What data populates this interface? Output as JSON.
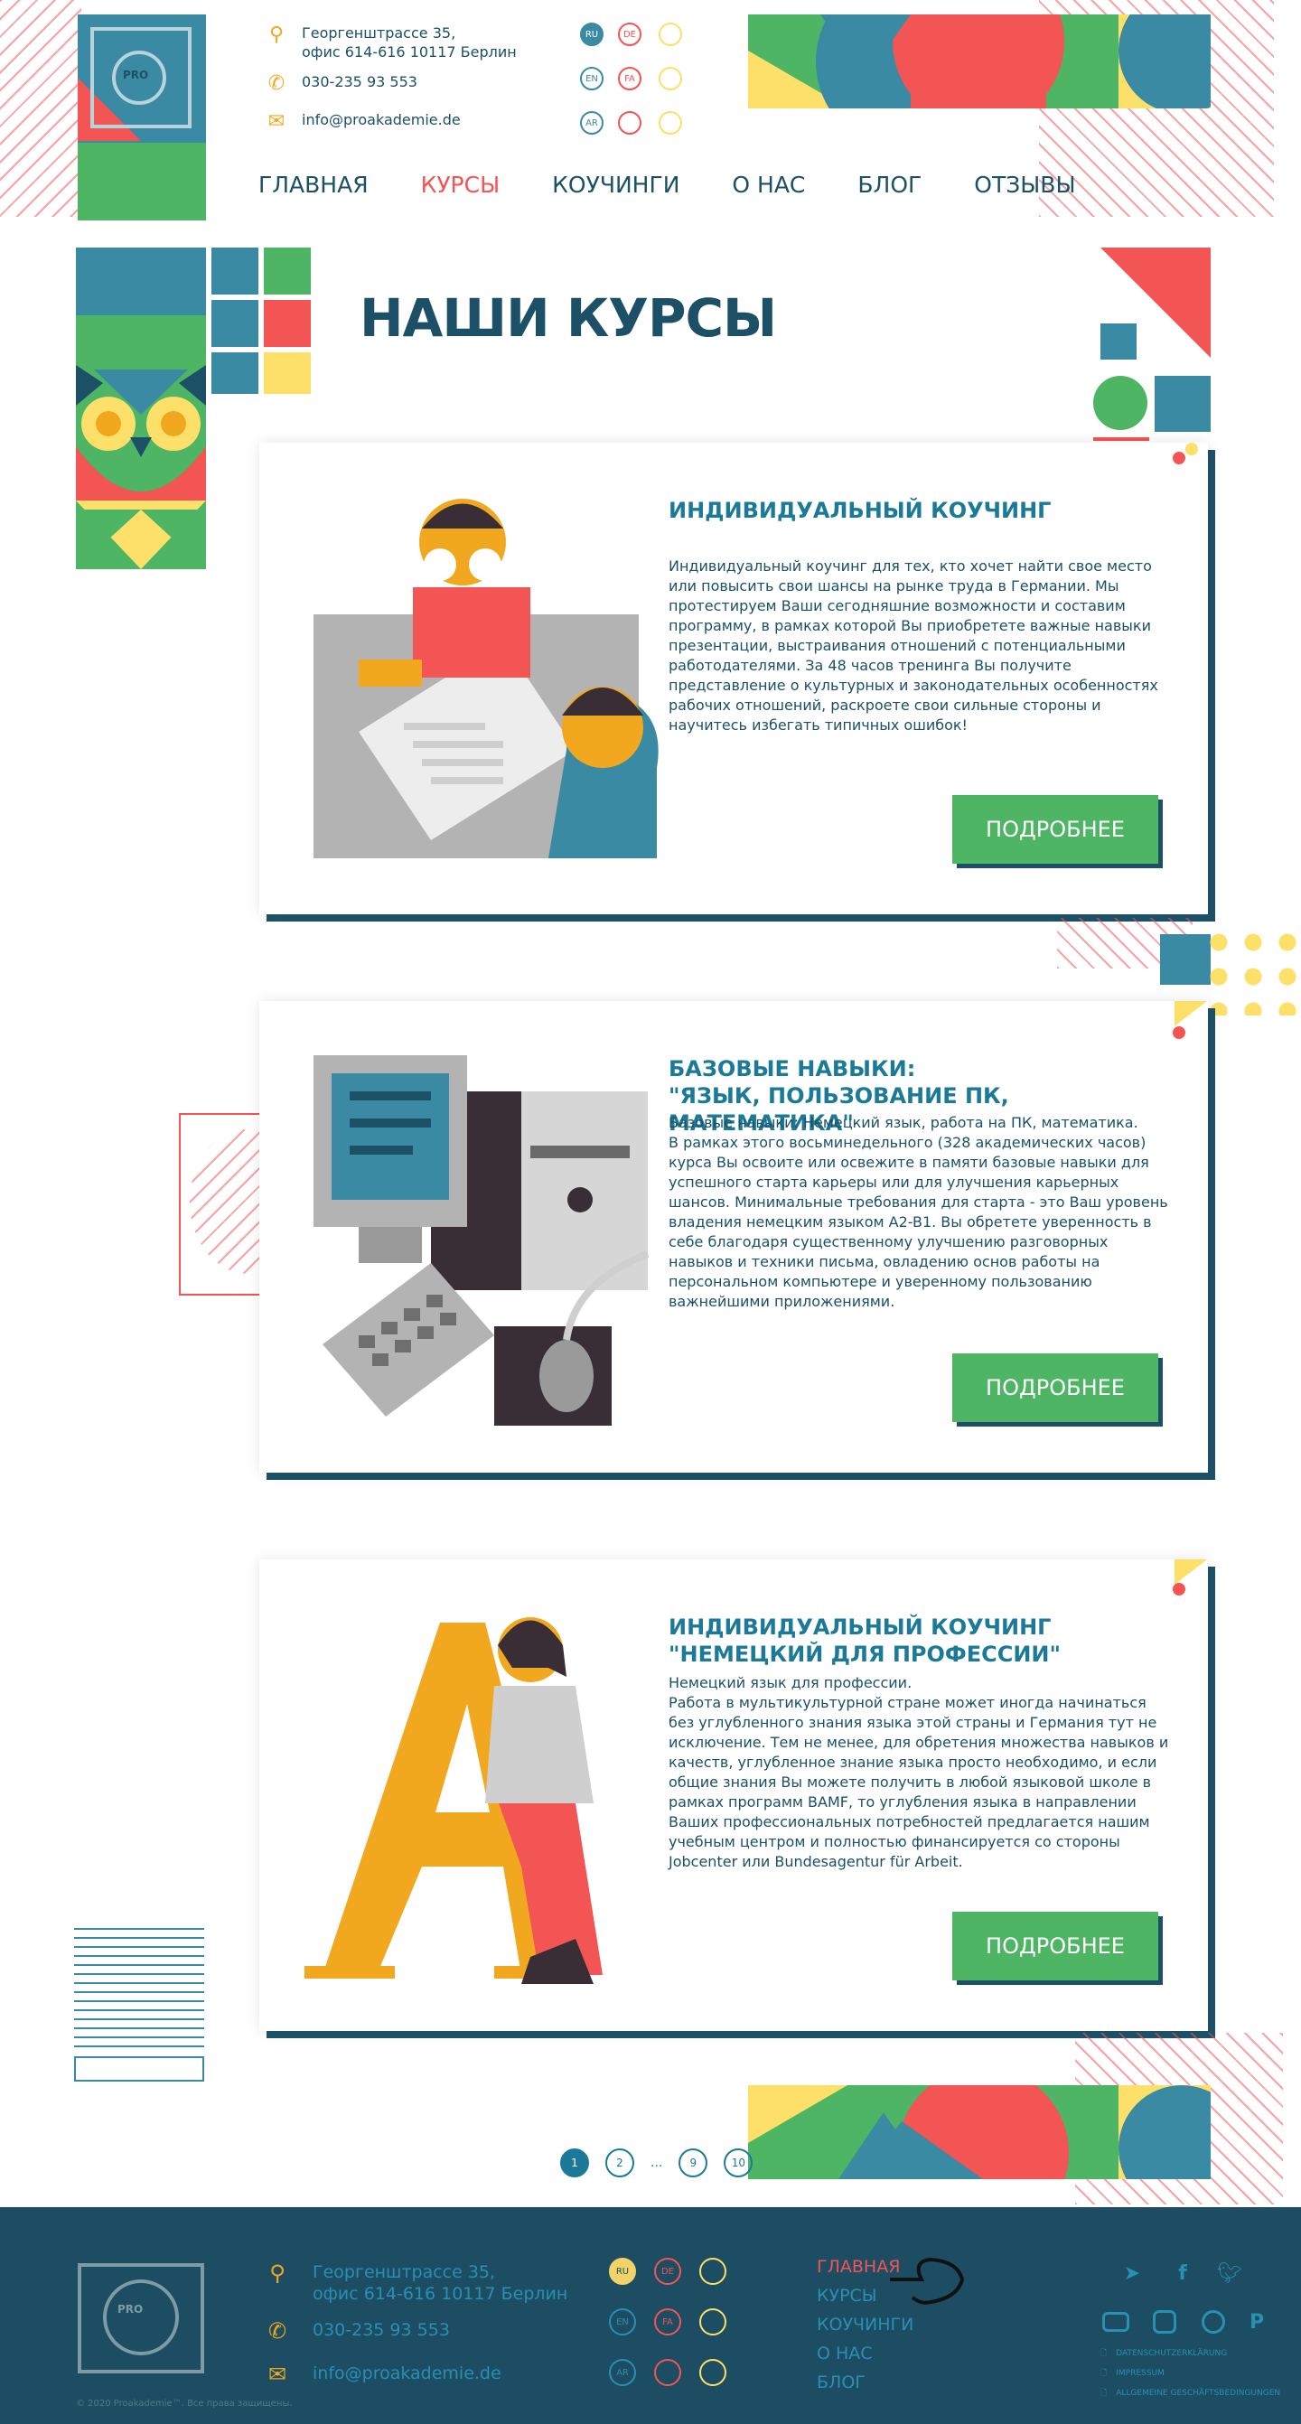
{
  "header": {
    "address_line1": "Георгенштрассе 35,",
    "address_line2": "офис 614-616 10117 Берлин",
    "phone": "030-235 93 553",
    "email": "info@proakademie.de",
    "langs": [
      "RU",
      "DE",
      "",
      "EN",
      "FA",
      "",
      "AR",
      "",
      ""
    ],
    "logo_text": "PRO"
  },
  "nav": {
    "items": [
      "ГЛАВНАЯ",
      "КУРСЫ",
      "КОУЧИНГИ",
      "О НАС",
      "БЛОГ",
      "ОТЗЫВЫ"
    ]
  },
  "page": {
    "title": "НАШИ КУРСЫ"
  },
  "courses": [
    {
      "title": "ИНДИВИДУАЛЬНЫЙ КОУЧИНГ",
      "text": "Индивидуальный коучинг для тех, кто хочет найти свое место или повысить свои шансы на рынке труда в Германии. Мы протестируем Ваши сегодняшние возможности и составим программу, в рамках которой Вы приобретете важные навыки презентации, выстраивания отношений с потенциальными работодателями. За 48 часов тренинга Вы получите представление о культурных и законодательных особенностях рабочих отношений, раскроете свои сильные стороны и научитесь избегать типичных ошибок!",
      "button": "ПОДРОБНЕЕ"
    },
    {
      "title": "БАЗОВЫЕ НАВЫКИ:\n\"ЯЗЫК, ПОЛЬЗОВАНИЕ ПК, МАТЕМАТИКА\"",
      "text": "Базовые навыки: Немецкий язык, работа на ПК, математика.\nВ рамках этого восьминедельного (328 академических часов) курса Вы освоите или освежите в памяти базовые навыки для успешного старта карьеры или для улучшения карьерных шансов. Минимальные требования для старта - это Ваш уровень владения немецким языком A2-B1. Вы обретете уверенность в себе благодаря существенному улучшению разговорных навыков и техники письма, овладению основ работы на персональном компьютере и уверенному пользованию важнейшими приложениями.",
      "button": "ПОДРОБНЕЕ"
    },
    {
      "title": "ИНДИВИДУАЛЬНЫЙ КОУЧИНГ \"НЕМЕЦКИЙ ДЛЯ ПРОФЕССИИ\"",
      "text": "Немецкий язык для профессии.\nРабота в мультикультурной стране может иногда начинаться без углубленного знания языка этой страны и Германия тут не исключение. Тем не менее, для обретения множества навыков и качеств, углубленное знание языка просто необходимо, и если общие знания Вы можете получить в любой языковой школе в рамках программ BAMF, то углубления языка в направлении Ваших профессиональных потребностей предлагается нашим учебным центром и полностью финансируется со стороны Jobcenter или Bundesagentur für Arbeit.",
      "button": "ПОДРОБНЕЕ"
    }
  ],
  "pagination": [
    "1",
    "2",
    "...",
    "9",
    "10"
  ],
  "footer": {
    "address_line1": "Георгенштрассе 35,",
    "address_line2": "офис 614-616 10117 Берлин",
    "phone": "030-235 93 553",
    "email": "info@proakademie.de",
    "nav": [
      "ГЛАВНАЯ",
      "КУРСЫ",
      "КОУЧИНГИ",
      "О НАС",
      "БЛОГ"
    ],
    "legal": [
      "DATENSCHUTZERKLÄRUNG",
      "IMPRESSUM",
      "ALLGEMEINE GESCHÄFTSBEDINGUNGEN"
    ],
    "copyright": "© 2020 Proakademie™. Все права защищены.",
    "social_icons": [
      "telegram-icon",
      "facebook-icon",
      "twitter-icon",
      "youtube-icon",
      "instagram-icon",
      "whatsapp-icon",
      "pinterest-icon"
    ]
  },
  "colors": {
    "primary": "#1c5066",
    "accent_red": "#f35454",
    "accent_green": "#4db564",
    "accent_yellow": "#fde06a",
    "accent_blue": "#3a8aa3",
    "footer_bg": "#1c4d62"
  }
}
